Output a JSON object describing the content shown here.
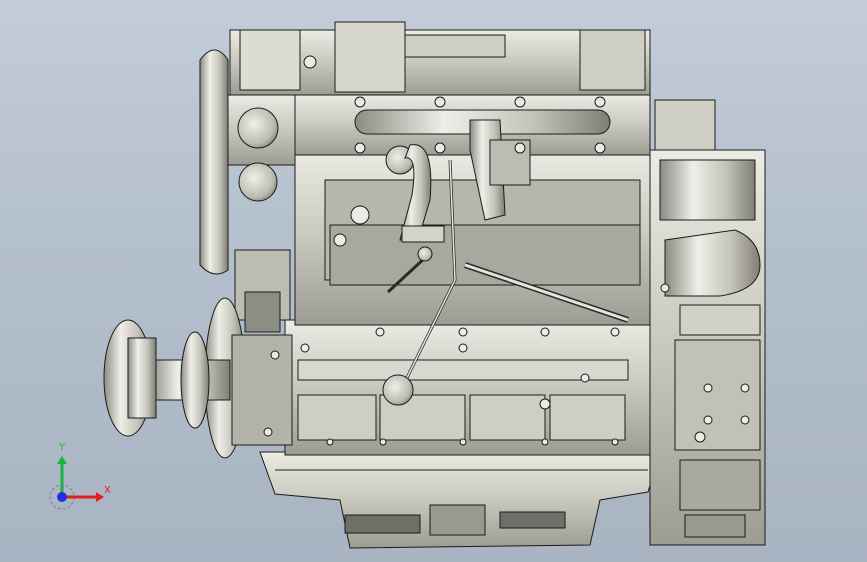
{
  "viewport": {
    "background_top": "#c3ccd8",
    "background_bottom": "#a9b4c3"
  },
  "model": {
    "description_icon": "engine-assembly-model",
    "shade_light": "#e6e5df",
    "shade_mid": "#c8c7bd",
    "shade_dark": "#8f8e85",
    "outline": "#1b1b1b"
  },
  "triad": {
    "x_label": "X",
    "y_label": "Y",
    "x_color": "#e02020",
    "y_color": "#20b040",
    "z_color": "#2030e0"
  }
}
